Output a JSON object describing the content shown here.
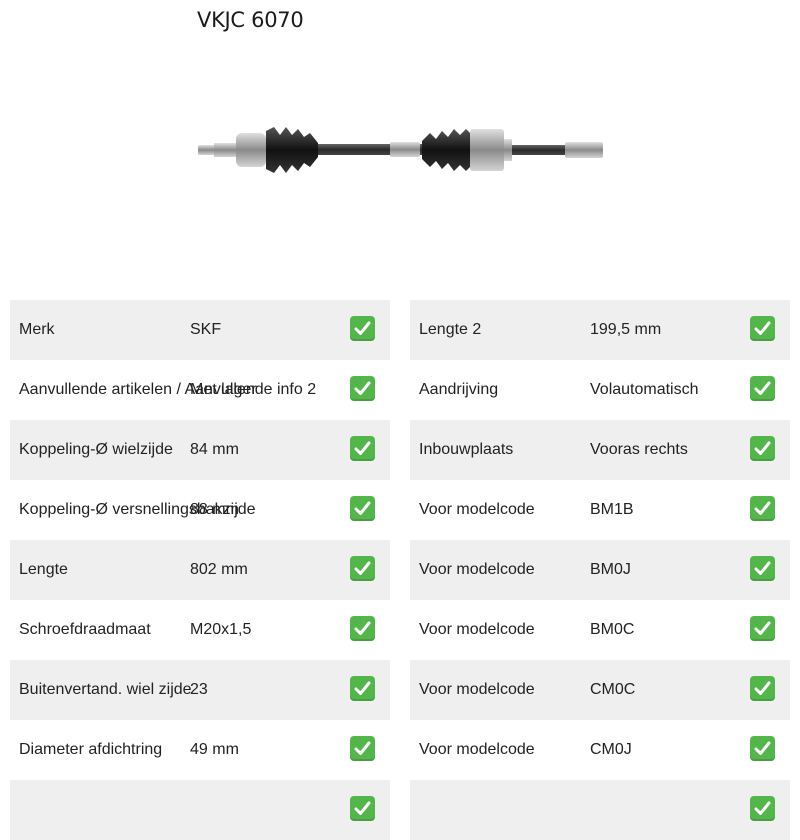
{
  "product": {
    "title": "VKJC 6070",
    "image_icon": "drive-shaft-image"
  },
  "colors": {
    "row_bg": "#efefef",
    "check_green": "#52b64a"
  },
  "specs_left": [
    {
      "label": "Merk",
      "value": "SKF",
      "icon": "check-icon"
    },
    {
      "label": "Aanvullende artikelen / Aanvullende info 2",
      "value": "Met lager",
      "icon": "check-icon"
    },
    {
      "label": "Koppeling-Ø wielzijde",
      "value": "84 mm",
      "icon": "check-icon"
    },
    {
      "label": "Koppeling-Ø versnellingsbakzijde",
      "value": "88 mm",
      "icon": "check-icon"
    },
    {
      "label": "Lengte",
      "value": "802 mm",
      "icon": "check-icon"
    },
    {
      "label": "Schroefdraadmaat",
      "value": "M20x1,5",
      "icon": "check-icon"
    },
    {
      "label": "Buitenvertand. wiel zijde",
      "value": "23",
      "icon": "check-icon"
    },
    {
      "label": "Diameter afdichtring",
      "value": "49 mm",
      "icon": "check-icon"
    },
    {
      "label": "",
      "value": "",
      "icon": "check-icon"
    }
  ],
  "specs_right": [
    {
      "label": "Lengte 2",
      "value": "199,5 mm",
      "icon": "check-icon"
    },
    {
      "label": "Aandrijving",
      "value": "Volautomatisch",
      "icon": "check-icon"
    },
    {
      "label": "Inbouwplaats",
      "value": "Vooras rechts",
      "icon": "check-icon"
    },
    {
      "label": "Voor modelcode",
      "value": "BM1B",
      "icon": "check-icon"
    },
    {
      "label": "Voor modelcode",
      "value": "BM0J",
      "icon": "check-icon"
    },
    {
      "label": "Voor modelcode",
      "value": "BM0C",
      "icon": "check-icon"
    },
    {
      "label": "Voor modelcode",
      "value": "CM0C",
      "icon": "check-icon"
    },
    {
      "label": "Voor modelcode",
      "value": "CM0J",
      "icon": "check-icon"
    },
    {
      "label": "",
      "value": "",
      "icon": "check-icon"
    }
  ]
}
